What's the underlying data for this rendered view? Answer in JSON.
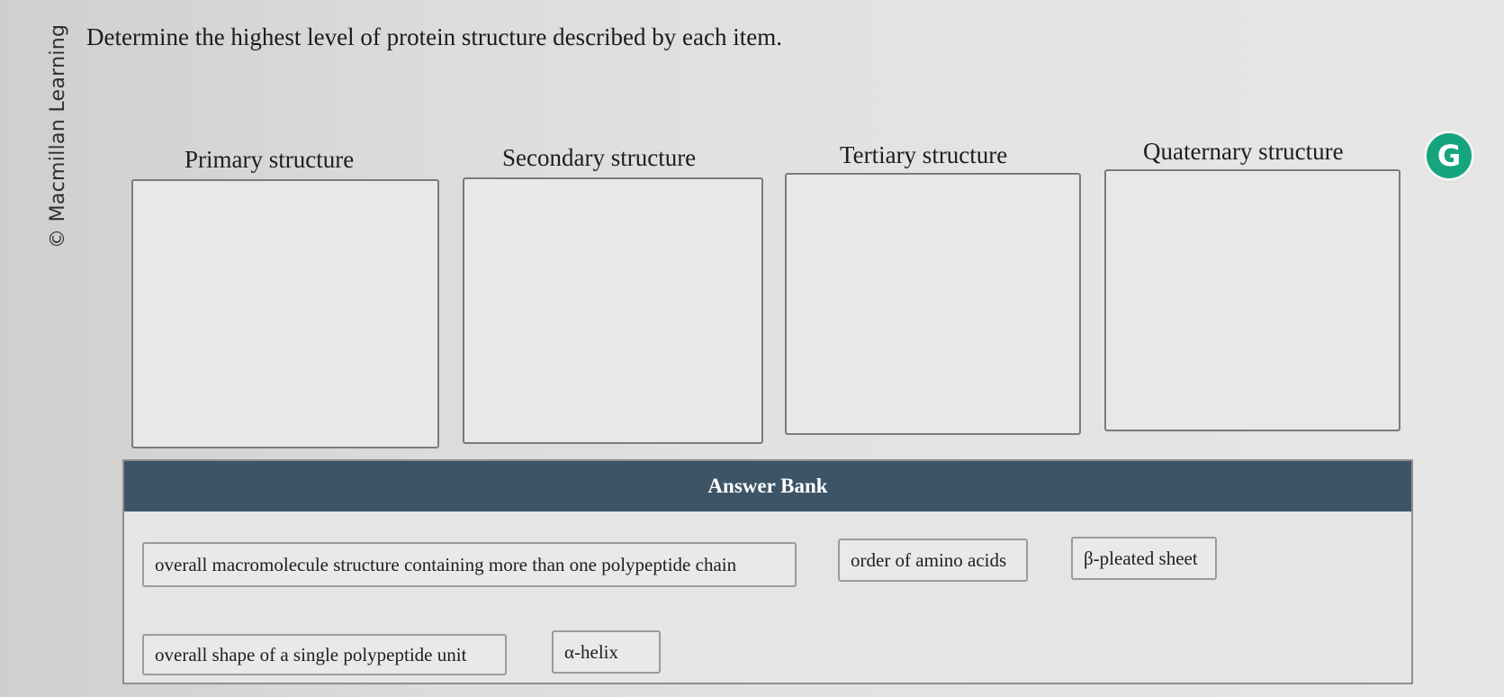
{
  "credit": "© Macmillan Learning",
  "prompt": "Determine the highest level of protein structure described by each item.",
  "targets": [
    {
      "label": "Primary structure"
    },
    {
      "label": "Secondary structure"
    },
    {
      "label": "Tertiary structure"
    },
    {
      "label": "Quaternary structure"
    }
  ],
  "answer_bank": {
    "title": "Answer Bank",
    "items": [
      "overall macromolecule structure containing more than one polypeptide chain",
      "order of amino acids",
      "β-pleated sheet",
      "overall shape of a single polypeptide unit",
      "α-helix"
    ]
  },
  "extension_badge": {
    "letter": "G",
    "color": "#15a57e"
  },
  "colors": {
    "bank_header": "#3d5466"
  }
}
